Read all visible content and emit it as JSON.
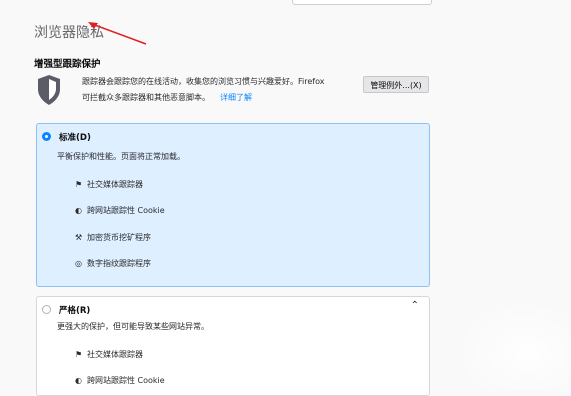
{
  "header": {
    "title": "浏览器隐私"
  },
  "tracking": {
    "heading": "增强型跟踪保护",
    "description_line1": "跟踪器会跟踪您的在线活动，收集您的浏览习惯与兴趣爱好。Firefox",
    "description_line2": "可拦截众多跟踪器和其他恶意脚本。",
    "learn_more": "详细了解",
    "manage_exceptions": "管理例外...(X)"
  },
  "options": {
    "standard": {
      "label": "标准(D)",
      "description": "平衡保护和性能。页面将正常加载。",
      "items": [
        {
          "icon": "social-tracker-icon",
          "label": "社交媒体跟踪器"
        },
        {
          "icon": "cookie-icon",
          "label": "跨网站跟踪性 Cookie"
        },
        {
          "icon": "cryptominer-icon",
          "label": "加密货币挖矿程序"
        },
        {
          "icon": "fingerprint-icon",
          "label": "数字指纹跟踪程序"
        }
      ],
      "selected": true
    },
    "strict": {
      "label": "严格(R)",
      "description": "更强大的保护，但可能导致某些网站异常。",
      "items": [
        {
          "icon": "social-tracker-icon",
          "label": "社交媒体跟踪器"
        },
        {
          "icon": "cookie-icon",
          "label": "跨网站跟踪性 Cookie"
        }
      ],
      "selected": false
    }
  },
  "colors": {
    "accent": "#0a84ff",
    "selected_bg": "#deefff",
    "annotation_arrow": "#e02020"
  }
}
